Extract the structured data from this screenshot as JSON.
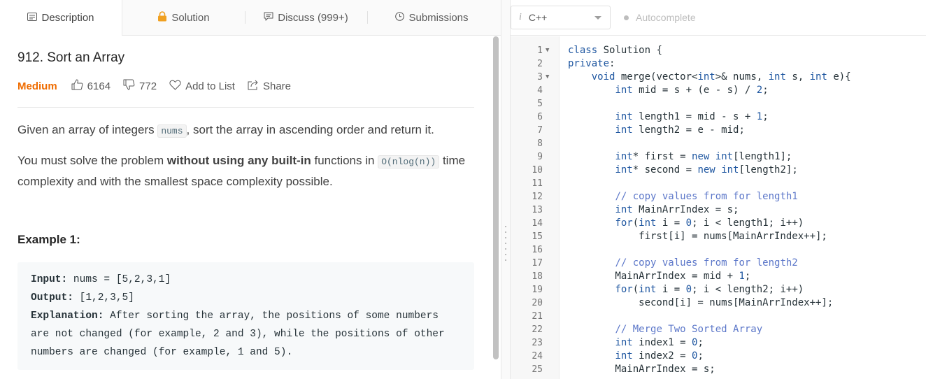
{
  "tabs": [
    {
      "label": "Description",
      "icon": "description-icon"
    },
    {
      "label": "Solution",
      "icon": "lock-icon"
    },
    {
      "label": "Discuss (999+)",
      "icon": "discuss-icon"
    },
    {
      "label": "Submissions",
      "icon": "clock-icon"
    }
  ],
  "problem": {
    "title": "912. Sort an Array",
    "difficulty": "Medium",
    "likes": "6164",
    "dislikes": "772",
    "add_to_list": "Add to List",
    "share": "Share"
  },
  "description": {
    "p1_before": "Given an array of integers ",
    "p1_code": "nums",
    "p1_after": ", sort the array in ascending order and return it.",
    "p2_before": "You must solve the problem ",
    "p2_bold": "without using any built-in",
    "p2_mid": " functions in ",
    "p2_code": "O(nlog(n))",
    "p2_after": " time complexity and with the smallest space complexity possible."
  },
  "example": {
    "title": "Example 1:",
    "input_label": "Input:",
    "input_value": " nums = [5,2,3,1]",
    "output_label": "Output:",
    "output_value": " [1,2,3,5]",
    "explanation_label": "Explanation:",
    "explanation_line1": " After sorting the array, the positions of some numbers",
    "explanation_line2": "are not changed (for example, 2 and 3), while the positions of other",
    "explanation_line3": "numbers are changed (for example, 1 and 5)."
  },
  "editor": {
    "language_icon": "i",
    "language": "C++",
    "autocomplete": "Autocomplete",
    "lines": [
      "class Solution {",
      "private:",
      "    void merge(vector<int>& nums, int s, int e){",
      "        int mid = s + (e - s) / 2;",
      "",
      "        int length1 = mid - s + 1;",
      "        int length2 = e - mid;",
      "",
      "        int* first = new int[length1];",
      "        int* second = new int[length2];",
      "",
      "        // copy values from for length1",
      "        int MainArrIndex = s;",
      "        for(int i = 0; i < length1; i++)",
      "            first[i] = nums[MainArrIndex++];",
      "",
      "        // copy values from for length2",
      "        MainArrIndex = mid + 1;",
      "        for(int i = 0; i < length2; i++)",
      "            second[i] = nums[MainArrIndex++];",
      "",
      "        // Merge Two Sorted Array",
      "        int index1 = 0;",
      "        int index2 = 0;",
      "        MainArrIndex = s;"
    ]
  },
  "colors": {
    "difficulty_medium": "#ef6c00",
    "keyword": "#1e56a0",
    "comment": "#5c77c9"
  }
}
